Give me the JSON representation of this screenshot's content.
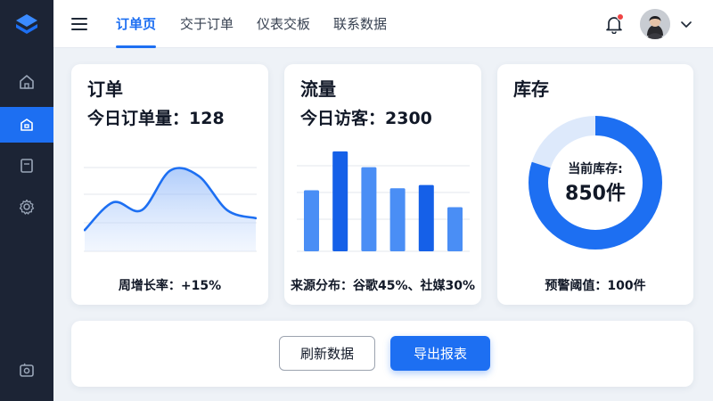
{
  "nav": {
    "tabs": [
      {
        "label": "订单页",
        "active": true
      },
      {
        "label": "交于订单",
        "active": false
      },
      {
        "label": "仪表交板",
        "active": false
      },
      {
        "label": "联系数据",
        "active": false
      }
    ]
  },
  "sidebar": {
    "items": [
      {
        "icon": "home-icon",
        "active": false
      },
      {
        "icon": "cube-icon",
        "active": true
      },
      {
        "icon": "document-icon",
        "active": false
      },
      {
        "icon": "gear-icon",
        "active": false
      },
      {
        "icon": "camera-icon",
        "active": false
      }
    ]
  },
  "cards": {
    "orders": {
      "title": "订单",
      "metric_label": "今日订单量：",
      "metric_value": "128",
      "footer": "周增长率：+15%"
    },
    "traffic": {
      "title": "流量",
      "metric_label": "今日访客：",
      "metric_value": "2300",
      "footer": "来源分布：谷歌45%、社媒30%"
    },
    "inventory": {
      "title": "库存",
      "ring_label": "当前库存:",
      "ring_value": "850件",
      "footer": "预警阈值：100件"
    }
  },
  "actions": {
    "refresh_label": "刷新数据",
    "export_label": "导出报表"
  },
  "colors": {
    "accent": "#1d6ff2",
    "sidebar_bg": "#1c2435",
    "ring_track": "#dde9fb",
    "bar_light": "#4a8ef5",
    "bar_dark": "#1560e8"
  },
  "chart_data": [
    {
      "type": "area",
      "x": [
        0,
        1,
        2,
        3,
        4,
        5,
        6
      ],
      "values": [
        20,
        55,
        45,
        95,
        88,
        45,
        35
      ],
      "ylim": [
        0,
        110
      ],
      "grid": true
    },
    {
      "type": "bar",
      "values": [
        58,
        95,
        80,
        60,
        63,
        42
      ],
      "shade": [
        "light",
        "dark",
        "light",
        "light",
        "dark",
        "light"
      ],
      "ylim": [
        0,
        100
      ],
      "grid": true
    },
    {
      "type": "pie",
      "values": [
        80,
        20
      ],
      "colors": [
        "#1d6ff2",
        "#dde9fb"
      ]
    }
  ]
}
